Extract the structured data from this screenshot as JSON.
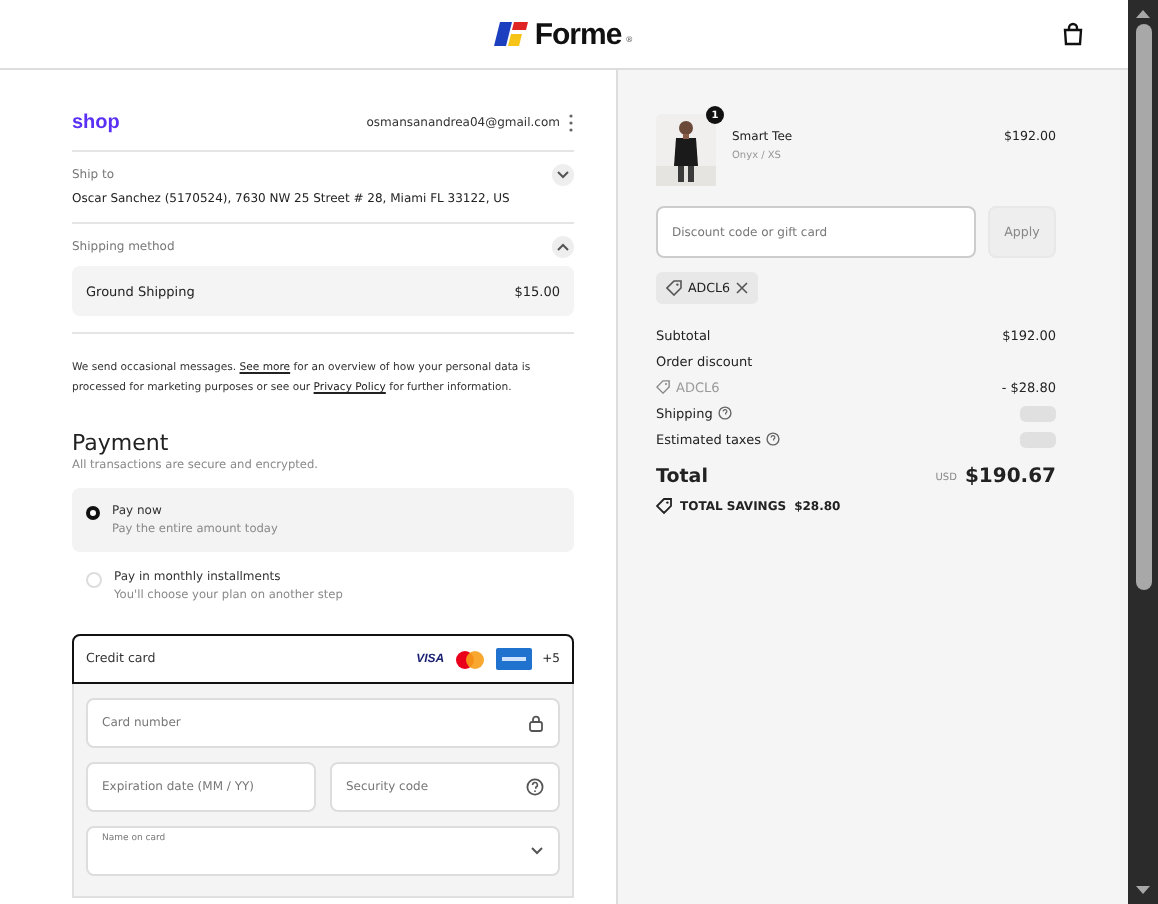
{
  "header": {
    "brand": "Forme",
    "registered": "®"
  },
  "account": {
    "provider": "shop",
    "email": "osmansanandrea04@gmail.com"
  },
  "ship_to": {
    "label": "Ship to",
    "address": "Oscar Sanchez (5170524), 7630 NW 25 Street # 28, Miami FL 33122, US",
    "expanded": false
  },
  "shipping_method": {
    "label": "Shipping method",
    "expanded": true,
    "options": [
      {
        "name": "Ground Shipping",
        "price": "$15.00"
      }
    ]
  },
  "notice": {
    "before": "We send occasional messages.",
    "link1": "See more",
    "middle": "for an overview of how your personal data is processed for marketing purposes or see our",
    "link2": "Privacy Policy",
    "after": "for further information."
  },
  "payment": {
    "title": "Payment",
    "subtitle": "All transactions are secure and encrypted.",
    "options": [
      {
        "label": "Pay now",
        "description": "Pay the entire amount today",
        "selected": true
      },
      {
        "label": "Pay in monthly installments",
        "description": "You'll choose your plan on another step",
        "selected": false
      }
    ],
    "method": {
      "label": "Credit card",
      "brands": [
        {
          "kind": "visa",
          "text": "VISA"
        },
        {
          "kind": "mastercard"
        },
        {
          "kind": "amex"
        },
        {
          "kind": "more",
          "text": "+5"
        }
      ]
    },
    "fields": [
      {
        "placeholder": "Card number",
        "kind": "card_number"
      },
      {
        "placeholder": "Expiration date (MM / YY)",
        "kind": "expiry"
      },
      {
        "placeholder": "Security code",
        "kind": "security_code"
      },
      {
        "label": "Name on card",
        "kind": "select"
      }
    ]
  },
  "order": {
    "items": [
      {
        "quantity": "1",
        "name": "Smart Tee",
        "variant": "Onyx / XS",
        "price": "$192.00"
      }
    ],
    "discount": {
      "placeholder": "Discount code or gift card",
      "button": "Apply",
      "disabled": true
    },
    "applied_codes": [
      "ADCL6"
    ],
    "summary": [
      {
        "kind": "amount",
        "label": "Subtotal",
        "value": "$192.00"
      },
      {
        "kind": "heading",
        "label": "Order discount"
      },
      {
        "kind": "code",
        "label": "ADCL6",
        "value": "- $28.80"
      },
      {
        "kind": "pending",
        "label": "Shipping"
      },
      {
        "kind": "pending",
        "label": "Estimated taxes"
      }
    ],
    "total": {
      "label": "Total",
      "currency": "USD",
      "value": "$190.67"
    },
    "savings": {
      "label": "TOTAL SAVINGS",
      "value": "$28.80"
    }
  }
}
